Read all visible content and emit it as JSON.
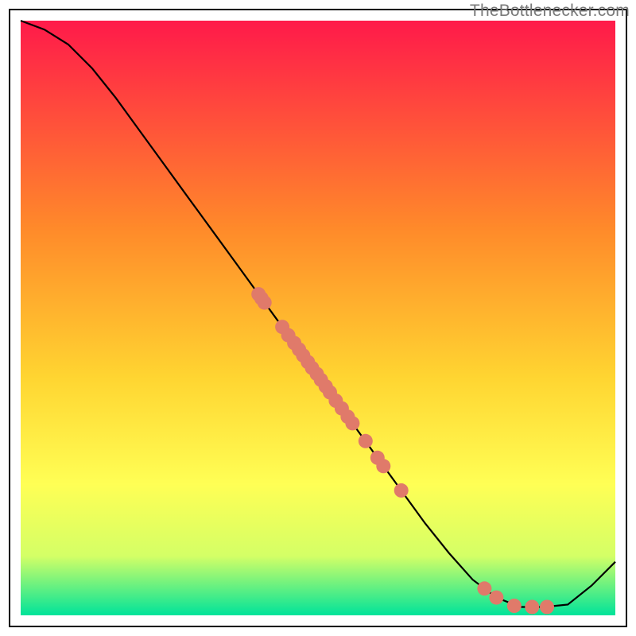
{
  "attribution": "TheBottlenecker.com",
  "colors": {
    "curve_stroke": "#000000",
    "dot_fill": "#e07a6a",
    "frame_stroke": "#000000",
    "grad_top": "#ff1a4a",
    "grad_mid1": "#ff6a2a",
    "grad_mid2": "#ffd531",
    "grad_mid3": "#ffff55",
    "grad_mid4": "#d4ff66",
    "grad_bottom": "#00e39a"
  },
  "chart_data": {
    "type": "line",
    "title": "",
    "xlabel": "",
    "ylabel": "",
    "xlim": [
      0,
      100
    ],
    "ylim": [
      0,
      100
    ],
    "curve": [
      {
        "x": 0,
        "y": 100
      },
      {
        "x": 4,
        "y": 98.5
      },
      {
        "x": 8,
        "y": 96
      },
      {
        "x": 12,
        "y": 92
      },
      {
        "x": 16,
        "y": 87
      },
      {
        "x": 20,
        "y": 81.5
      },
      {
        "x": 24,
        "y": 76
      },
      {
        "x": 28,
        "y": 70.5
      },
      {
        "x": 32,
        "y": 65
      },
      {
        "x": 36,
        "y": 59.5
      },
      {
        "x": 40,
        "y": 54
      },
      {
        "x": 44,
        "y": 48.5
      },
      {
        "x": 48,
        "y": 43
      },
      {
        "x": 52,
        "y": 37.5
      },
      {
        "x": 56,
        "y": 32
      },
      {
        "x": 60,
        "y": 26.5
      },
      {
        "x": 64,
        "y": 21
      },
      {
        "x": 68,
        "y": 15.5
      },
      {
        "x": 72,
        "y": 10.5
      },
      {
        "x": 76,
        "y": 6
      },
      {
        "x": 80,
        "y": 3
      },
      {
        "x": 84,
        "y": 1.4
      },
      {
        "x": 88,
        "y": 1.4
      },
      {
        "x": 92,
        "y": 1.8
      },
      {
        "x": 96,
        "y": 5
      },
      {
        "x": 100,
        "y": 9
      }
    ],
    "dots": [
      {
        "x": 40.0,
        "y": 54.0
      },
      {
        "x": 40.5,
        "y": 53.3
      },
      {
        "x": 41.0,
        "y": 52.6
      },
      {
        "x": 44.0,
        "y": 48.5
      },
      {
        "x": 45.0,
        "y": 47.1
      },
      {
        "x": 46.0,
        "y": 45.8
      },
      {
        "x": 46.8,
        "y": 44.7
      },
      {
        "x": 47.5,
        "y": 43.7
      },
      {
        "x": 48.3,
        "y": 42.6
      },
      {
        "x": 49.0,
        "y": 41.6
      },
      {
        "x": 49.8,
        "y": 40.6
      },
      {
        "x": 50.5,
        "y": 39.6
      },
      {
        "x": 51.3,
        "y": 38.5
      },
      {
        "x": 52.0,
        "y": 37.5
      },
      {
        "x": 53.0,
        "y": 36.1
      },
      {
        "x": 54.0,
        "y": 34.8
      },
      {
        "x": 55.0,
        "y": 33.4
      },
      {
        "x": 55.8,
        "y": 32.3
      },
      {
        "x": 58.0,
        "y": 29.3
      },
      {
        "x": 60.0,
        "y": 26.5
      },
      {
        "x": 61.0,
        "y": 25.1
      },
      {
        "x": 64.0,
        "y": 21.0
      },
      {
        "x": 78.0,
        "y": 4.5
      },
      {
        "x": 80.0,
        "y": 3.0
      },
      {
        "x": 83.0,
        "y": 1.6
      },
      {
        "x": 86.0,
        "y": 1.4
      },
      {
        "x": 88.5,
        "y": 1.4
      }
    ]
  }
}
